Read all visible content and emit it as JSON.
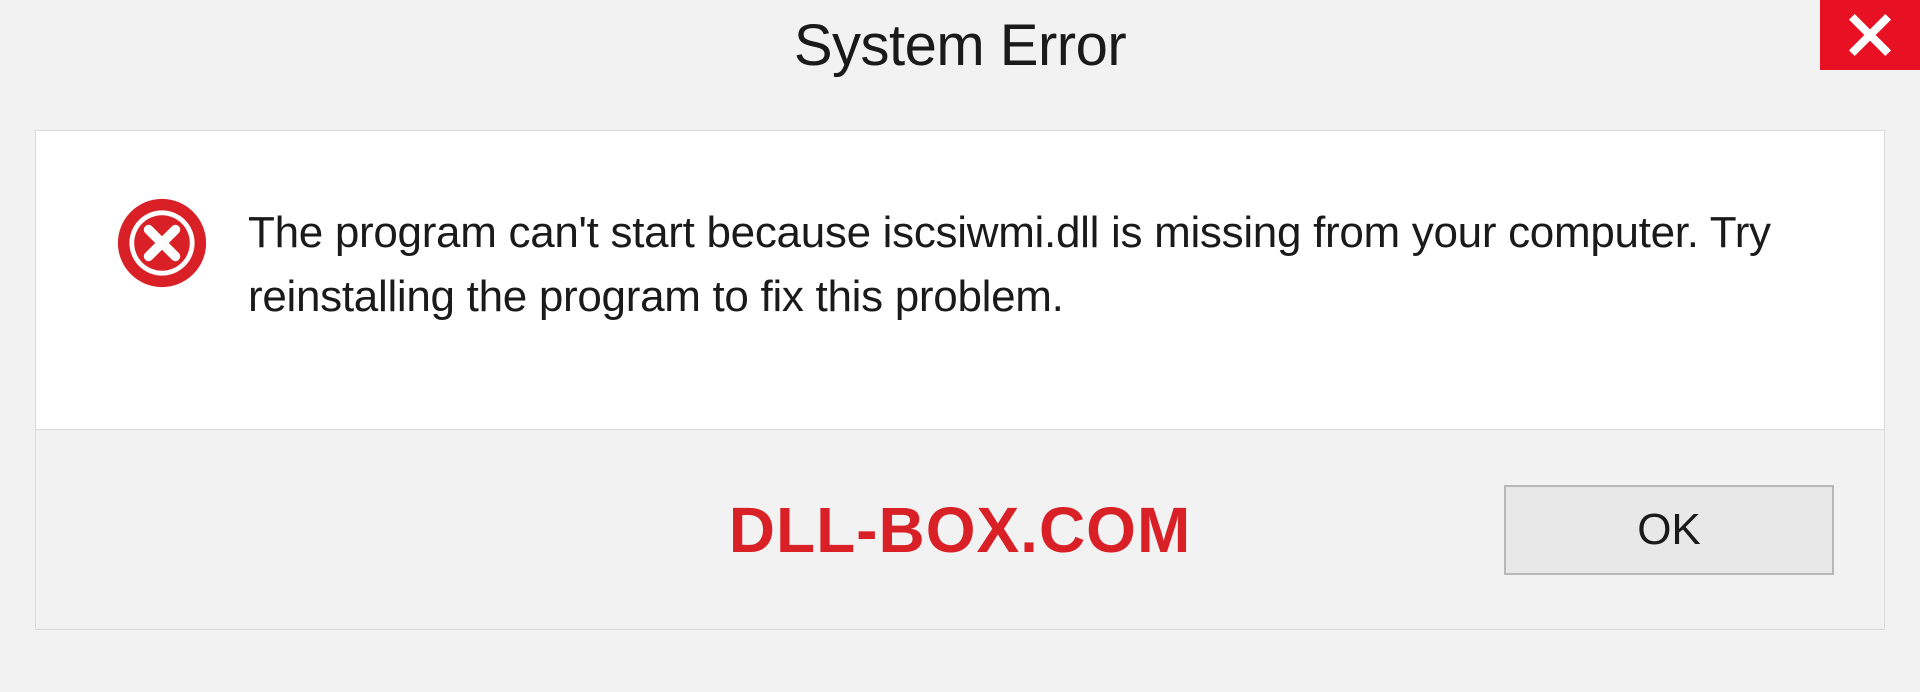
{
  "dialog": {
    "title": "System Error",
    "message": "The program can't start because iscsiwmi.dll is missing from your computer. Try reinstalling the program to fix this problem.",
    "ok_label": "OK"
  },
  "watermark": "DLL-BOX.COM",
  "colors": {
    "close_bg": "#e81123",
    "error_icon": "#d92027",
    "watermark": "#d92027"
  }
}
